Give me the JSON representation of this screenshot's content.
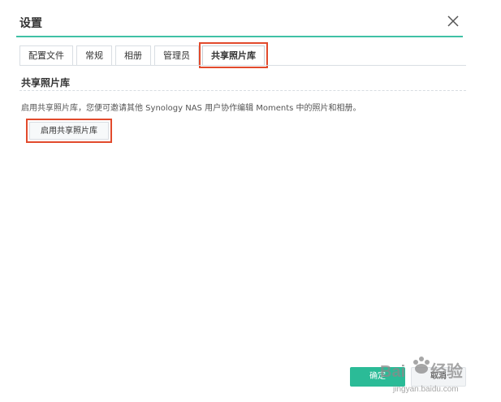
{
  "dialog": {
    "title": "设置",
    "close_icon": "close-icon"
  },
  "tabs": [
    {
      "label": "配置文件",
      "active": false
    },
    {
      "label": "常规",
      "active": false
    },
    {
      "label": "相册",
      "active": false
    },
    {
      "label": "管理员",
      "active": false
    },
    {
      "label": "共享照片库",
      "active": true
    }
  ],
  "section": {
    "title": "共享照片库",
    "description": "启用共享照片库，您便可邀请其他 Synology NAS 用户协作编辑 Moments 中的照片和相册。",
    "enable_button": "启用共享照片库"
  },
  "footer": {
    "ok_label": "确定",
    "cancel_label": "取消"
  },
  "watermark": {
    "text": "Baidu经验",
    "subtext": "jingyan.baidu.com"
  },
  "colors": {
    "accent": "#2bbb97",
    "title_rule": "#3fc1a5",
    "highlight": "#e24a2c"
  }
}
